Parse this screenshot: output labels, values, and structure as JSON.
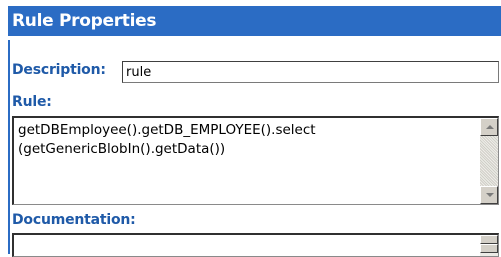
{
  "panel": {
    "title": "Rule Properties"
  },
  "description": {
    "label": "Description:",
    "value": "rule"
  },
  "rule": {
    "label": "Rule:",
    "text": "getDBEmployee().getDB_EMPLOYEE().select\n(getGenericBlobIn().getData())"
  },
  "documentation": {
    "label": "Documentation:",
    "text": ""
  },
  "icons": {
    "scroll_up": "scroll-up-arrow-icon",
    "scroll_down": "scroll-down-arrow-icon"
  },
  "colors": {
    "header_bg": "#2b6cc4",
    "label": "#1f5aa8"
  }
}
